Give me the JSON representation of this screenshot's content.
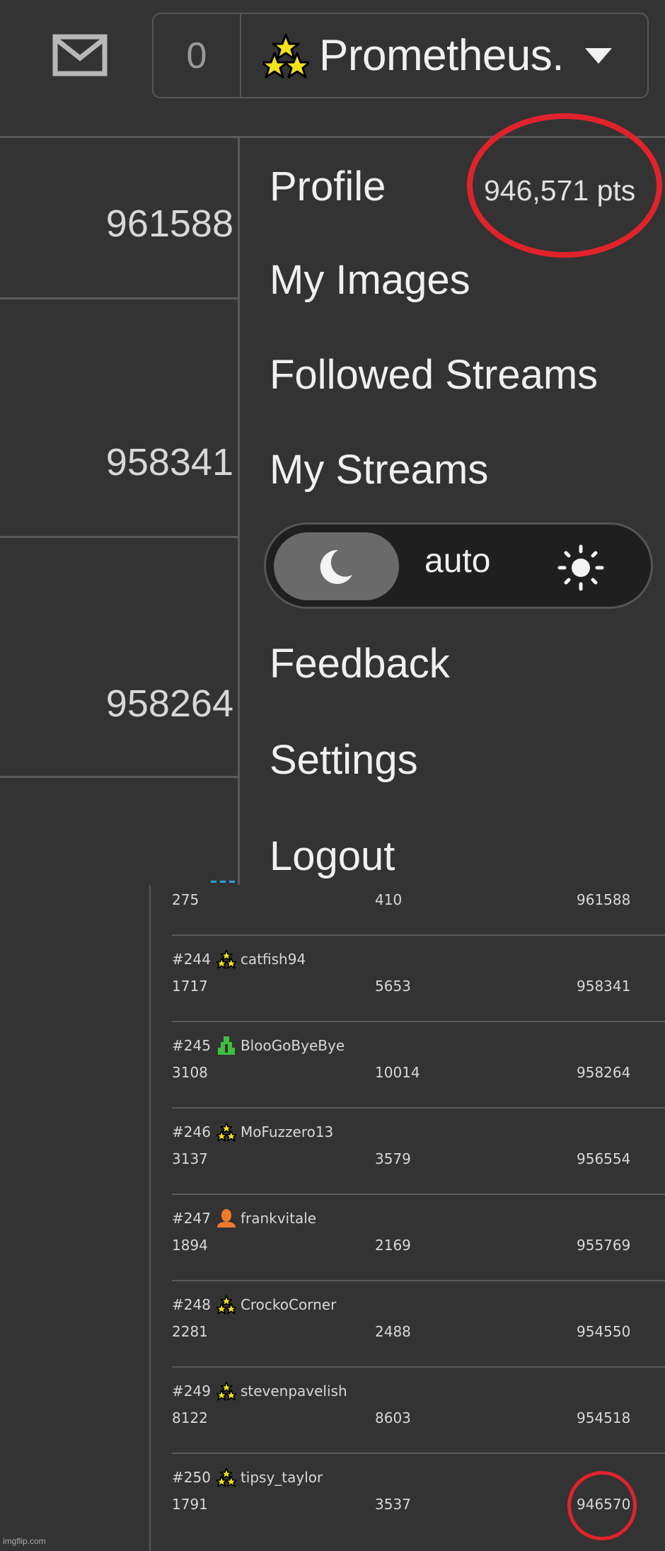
{
  "header": {
    "notification_count": "0",
    "username": "Prometheus.",
    "user_rank_icon": "three-stars-icon",
    "mail_icon": "mail-icon",
    "dropdown_icon": "caret-down-icon"
  },
  "left_scores": [
    "961588",
    "958341",
    "958264"
  ],
  "user_menu": {
    "profile_label": "Profile",
    "profile_points": "946,571 pts",
    "items": [
      "My Images",
      "Followed Streams",
      "My Streams",
      "Feedback",
      "Settings",
      "Logout"
    ],
    "theme_toggle": {
      "selected": "dark",
      "dark_icon": "moon-icon",
      "auto_label": "auto",
      "light_icon": "sun-icon"
    }
  },
  "leaderboard": {
    "partial_row": {
      "c1": "275",
      "c2": "410",
      "c3": "961588"
    },
    "rows": [
      {
        "rank": "#244",
        "avatar": "three-stars-icon",
        "name": "catfish94",
        "c1": "1717",
        "c2": "5653",
        "c3": "958341"
      },
      {
        "rank": "#245",
        "avatar": "green-tower-icon",
        "name": "BlooGoByeBye",
        "c1": "3108",
        "c2": "10014",
        "c3": "958264"
      },
      {
        "rank": "#246",
        "avatar": "three-stars-icon",
        "name": "MoFuzzero13",
        "c1": "3137",
        "c2": "3579",
        "c3": "956554"
      },
      {
        "rank": "#247",
        "avatar": "orange-user-icon",
        "name": "frankvitale",
        "c1": "1894",
        "c2": "2169",
        "c3": "955769"
      },
      {
        "rank": "#248",
        "avatar": "three-stars-icon",
        "name": "CrockoCorner",
        "c1": "2281",
        "c2": "2488",
        "c3": "954550"
      },
      {
        "rank": "#249",
        "avatar": "three-stars-icon",
        "name": "stevenpavelish",
        "c1": "8122",
        "c2": "8603",
        "c3": "954518"
      },
      {
        "rank": "#250",
        "avatar": "three-stars-icon",
        "name": "tipsy_taylor",
        "c1": "1791",
        "c2": "3537",
        "c3": "946570"
      }
    ]
  },
  "annotations": {
    "highlight_color": "#e0232b"
  },
  "watermark": "imgflip.com"
}
